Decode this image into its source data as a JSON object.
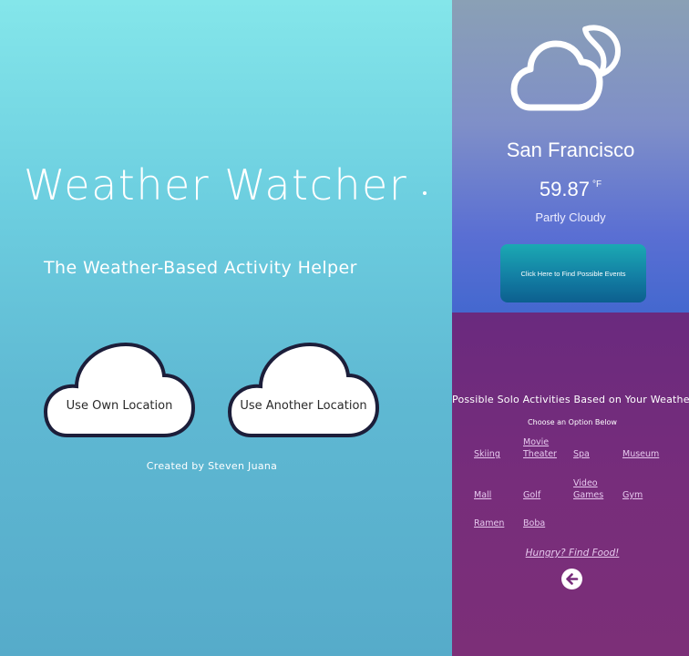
{
  "landing": {
    "title": "Weather Watcher",
    "subtitle": "The Weather-Based Activity Helper",
    "own_location_label": "Use Own Location",
    "another_location_label": "Use Another Location",
    "credit": "Created by Steven Juana"
  },
  "weather": {
    "icon": "cloud-moon-icon",
    "city": "San Francisco",
    "temperature": "59.87",
    "unit": "°F",
    "condition": "Partly Cloudy",
    "events_button_label": "Click Here to Find Possible Events"
  },
  "activities": {
    "title": "Possible Solo Activities Based on Your Weather",
    "subtitle": "Choose an Option Below",
    "options": [
      "Skiing",
      "Movie Theater",
      "Spa",
      "Museum",
      "Mall",
      "Golf",
      "Video Games",
      "Gym",
      "Ramen",
      "Boba"
    ],
    "food_link": "Hungry? Find Food!",
    "back_icon": "arrow-left-icon"
  },
  "colors": {
    "landing_bg": "#6dcfe0",
    "weather_bg": "#5a6fd3",
    "activities_bg": "#772d7b",
    "events_button": "#137fa4",
    "link": "#e6c8ee"
  }
}
